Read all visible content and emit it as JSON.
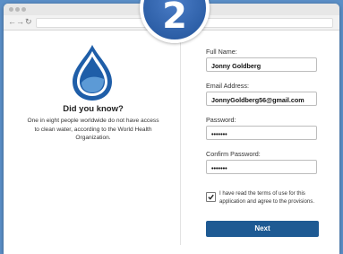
{
  "step": {
    "number": "2"
  },
  "browser": {
    "nav": {
      "back": "←",
      "forward": "→",
      "refresh": "↻"
    }
  },
  "info": {
    "title": "Did you know?",
    "body": "One in eight people worldwide do not have access to clean water, according to the World Health Organization."
  },
  "form": {
    "full_name": {
      "label": "Full Name:",
      "value": "Jonny Goldberg"
    },
    "email": {
      "label": "Email Address:",
      "value": "JonnyGoldberg56@gmail.com"
    },
    "password": {
      "label": "Password:",
      "value": "•••••••"
    },
    "confirm_password": {
      "label": "Confirm Password:",
      "value": "•••••••"
    },
    "terms": {
      "checked": true,
      "text": "I have read the terms of use for this application and agree to the provisions."
    },
    "submit_label": "Next"
  },
  "colors": {
    "background": "#5b8fc7",
    "badge": "#2d5fa7",
    "button": "#1e5a93",
    "drop_outer": "#1f5ea8",
    "drop_inner": "#5c9ad6"
  }
}
